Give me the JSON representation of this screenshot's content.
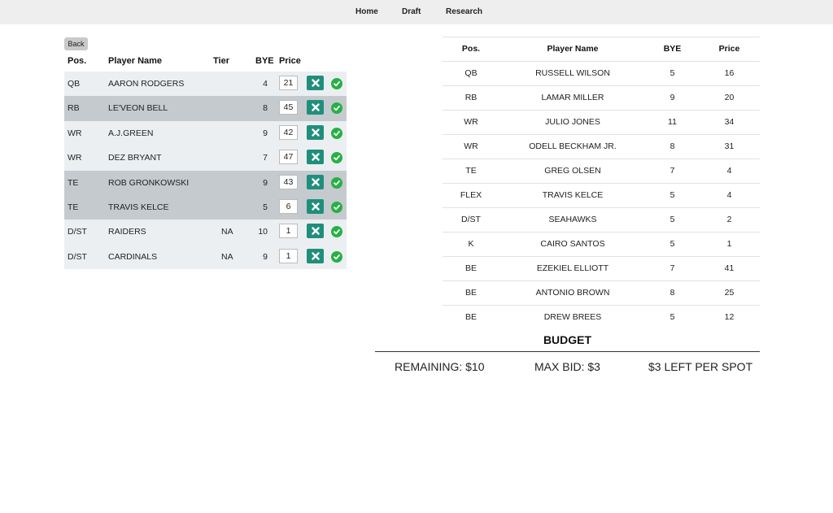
{
  "nav": {
    "home": "Home",
    "draft": "Draft",
    "research": "Research"
  },
  "back_label": "Back",
  "colors": {
    "remove_button": "#1f8f7b",
    "confirm_check": "#27b045",
    "highlight_row": "#c5cacf",
    "row": "#eceff1"
  },
  "left_table": {
    "headers": {
      "pos": "Pos.",
      "name": "Player Name",
      "tier": "Tier",
      "bye": "BYE",
      "price": "Price"
    },
    "rows": [
      {
        "pos": "QB",
        "name": "AARON RODGERS",
        "tier": "",
        "bye": "4",
        "price": "21",
        "highlighted": false
      },
      {
        "pos": "RB",
        "name": "LE'VEON BELL",
        "tier": "",
        "bye": "8",
        "price": "45",
        "highlighted": true
      },
      {
        "pos": "WR",
        "name": "A.J.GREEN",
        "tier": "",
        "bye": "9",
        "price": "42",
        "highlighted": false
      },
      {
        "pos": "WR",
        "name": "DEZ BRYANT",
        "tier": "",
        "bye": "7",
        "price": "47",
        "highlighted": false
      },
      {
        "pos": "TE",
        "name": "ROB GRONKOWSKI",
        "tier": "",
        "bye": "9",
        "price": "43",
        "highlighted": true
      },
      {
        "pos": "TE",
        "name": "TRAVIS KELCE",
        "tier": "",
        "bye": "5",
        "price": "6",
        "highlighted": true
      },
      {
        "pos": "D/ST",
        "name": "RAIDERS",
        "tier": "NA",
        "bye": "10",
        "price": "1",
        "highlighted": false
      },
      {
        "pos": "D/ST",
        "name": "CARDINALS",
        "tier": "NA",
        "bye": "9",
        "price": "1",
        "highlighted": false
      }
    ]
  },
  "roster_table": {
    "headers": {
      "pos": "Pos.",
      "name": "Player Name",
      "bye": "BYE",
      "price": "Price"
    },
    "rows": [
      {
        "pos": "QB",
        "name": "RUSSELL WILSON",
        "bye": "5",
        "price": "16"
      },
      {
        "pos": "RB",
        "name": "LAMAR MILLER",
        "bye": "9",
        "price": "20"
      },
      {
        "pos": "WR",
        "name": "JULIO JONES",
        "bye": "11",
        "price": "34"
      },
      {
        "pos": "WR",
        "name": "ODELL BECKHAM JR.",
        "bye": "8",
        "price": "31"
      },
      {
        "pos": "TE",
        "name": "GREG OLSEN",
        "bye": "7",
        "price": "4"
      },
      {
        "pos": "FLEX",
        "name": "TRAVIS KELCE",
        "bye": "5",
        "price": "4"
      },
      {
        "pos": "D/ST",
        "name": "SEAHAWKS",
        "bye": "5",
        "price": "2"
      },
      {
        "pos": "K",
        "name": "CAIRO SANTOS",
        "bye": "5",
        "price": "1"
      },
      {
        "pos": "BE",
        "name": "EZEKIEL ELLIOTT",
        "bye": "7",
        "price": "41"
      },
      {
        "pos": "BE",
        "name": "ANTONIO BROWN",
        "bye": "8",
        "price": "25"
      },
      {
        "pos": "BE",
        "name": "DREW BREES",
        "bye": "5",
        "price": "12"
      }
    ]
  },
  "budget": {
    "title": "BUDGET",
    "remaining": "REMAINING: $10",
    "max_bid": "MAX BID: $3",
    "per_spot": "$3 LEFT PER SPOT"
  }
}
